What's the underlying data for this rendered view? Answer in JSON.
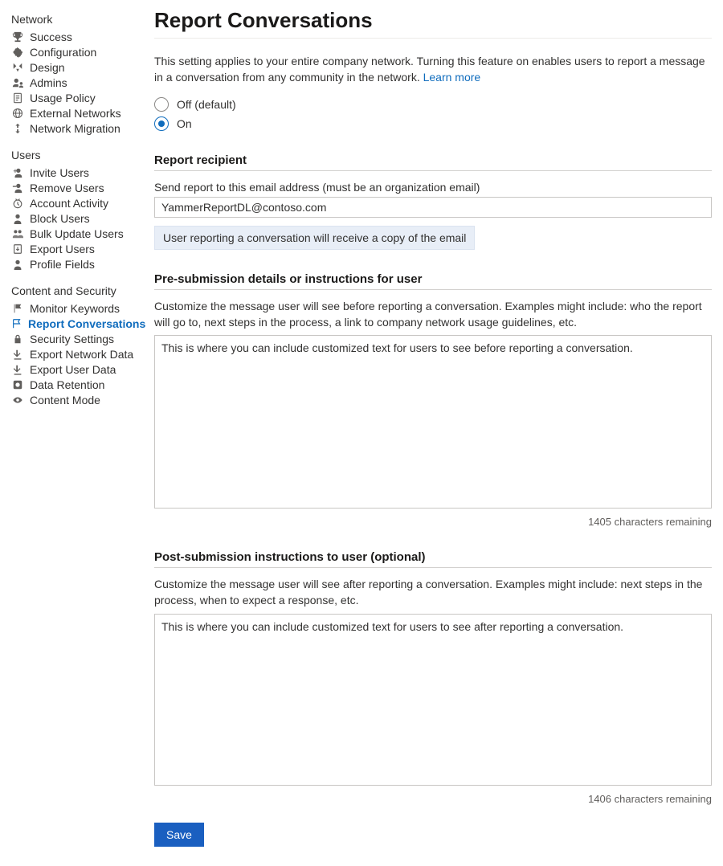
{
  "sidebar": {
    "groups": [
      {
        "title": "Network",
        "items": [
          {
            "label": "Success"
          },
          {
            "label": "Configuration"
          },
          {
            "label": "Design"
          },
          {
            "label": "Admins"
          },
          {
            "label": "Usage Policy"
          },
          {
            "label": "External Networks"
          },
          {
            "label": "Network Migration"
          }
        ]
      },
      {
        "title": "Users",
        "items": [
          {
            "label": "Invite Users"
          },
          {
            "label": "Remove Users"
          },
          {
            "label": "Account Activity"
          },
          {
            "label": "Block Users"
          },
          {
            "label": "Bulk Update Users"
          },
          {
            "label": "Export Users"
          },
          {
            "label": "Profile Fields"
          }
        ]
      },
      {
        "title": "Content and Security",
        "items": [
          {
            "label": "Monitor Keywords"
          },
          {
            "label": "Report Conversations"
          },
          {
            "label": "Security Settings"
          },
          {
            "label": "Export Network Data"
          },
          {
            "label": "Export User Data"
          },
          {
            "label": "Data Retention"
          },
          {
            "label": "Content Mode"
          }
        ]
      }
    ]
  },
  "page": {
    "title": "Report Conversations",
    "intro_text": "This setting applies to your entire company network. Turning this feature on enables users to report a message in a conversation from any community in the network. ",
    "learn_more": "Learn more",
    "toggle": {
      "off_label": "Off (default)",
      "on_label": "On",
      "selected": "on"
    },
    "recipient": {
      "heading": "Report recipient",
      "label": "Send report to this email address (must be an organization email)",
      "value": "YammerReportDL@contoso.com",
      "note": "User reporting a conversation will receive a copy of the email"
    },
    "pre": {
      "heading": "Pre-submission details or instructions for user",
      "help": "Customize the message user will see before reporting a conversation. Examples might include: who the report will go to, next steps in the process, a link to company network usage guidelines, etc.",
      "value": "This is where you can include customized text for users to see before reporting a conversation.",
      "counter": "1405 characters remaining"
    },
    "post": {
      "heading": "Post-submission instructions to user (optional)",
      "help": "Customize the message user will see after reporting a conversation. Examples might include: next steps in the process, when to expect a response, etc.",
      "value": "This is where you can include customized text for users to see after reporting a conversation.",
      "counter": "1406 characters remaining"
    },
    "save_label": "Save"
  }
}
